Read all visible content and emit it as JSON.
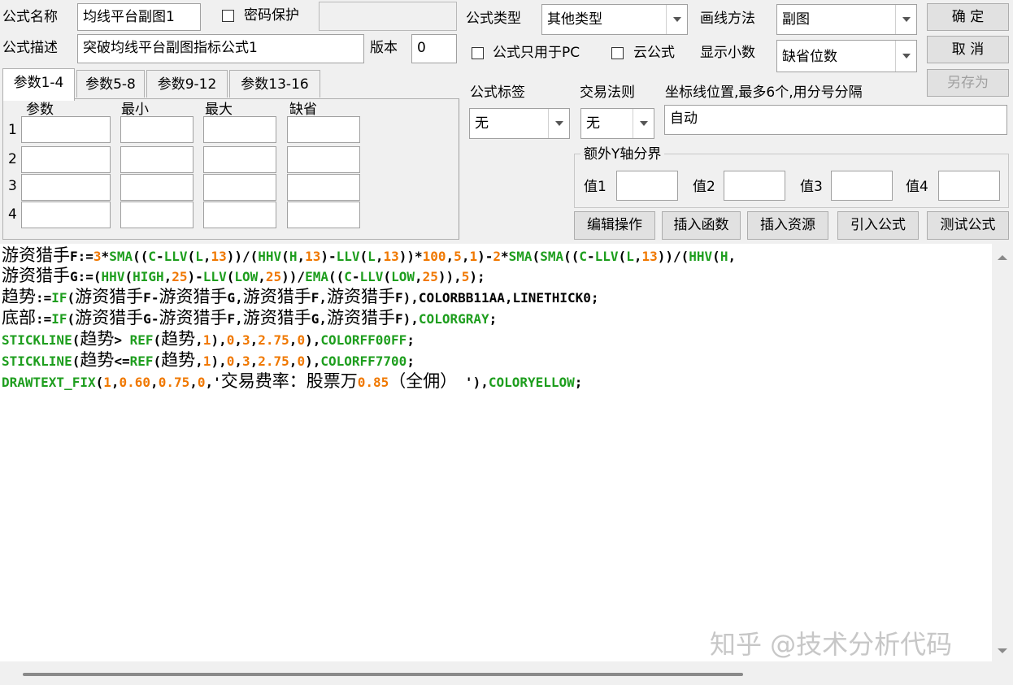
{
  "header": {
    "name_label": "公式名称",
    "name_value": "均线平台副图1",
    "password_label": "密码保护",
    "password_value": "",
    "desc_label": "公式描述",
    "desc_value": "突破均线平台副图指标公式1",
    "version_label": "版本",
    "version_value": "0",
    "type_label": "公式类型",
    "type_value": "其他类型",
    "draw_label": "画线方法",
    "draw_value": "副图",
    "pc_only_label": "公式只用于PC",
    "cloud_label": "云公式",
    "decimal_label": "显示小数",
    "decimal_value": "缺省位数"
  },
  "buttons": {
    "ok": "确  定",
    "cancel": "取  消",
    "save_as": "另存为",
    "edit_ops": "编辑操作",
    "insert_func": "插入函数",
    "insert_res": "插入资源",
    "import_formula": "引入公式",
    "test_formula": "测试公式"
  },
  "tabs": [
    "参数1-4",
    "参数5-8",
    "参数9-12",
    "参数13-16"
  ],
  "params": {
    "headers": [
      "参数",
      "最小",
      "最大",
      "缺省"
    ],
    "rows": [
      "1",
      "2",
      "3",
      "4"
    ]
  },
  "options": {
    "tag_label": "公式标签",
    "tag_value": "无",
    "trade_label": "交易法则",
    "trade_value": "无",
    "axis_label": "坐标线位置,最多6个,用分号分隔",
    "axis_value": "自动",
    "yaxis_group": "额外Y轴分界",
    "v1": "值1",
    "v2": "值2",
    "v3": "值3",
    "v4": "值4"
  },
  "code_lines": [
    "游资猎手F:=3*SMA((C-LLV(L,13))/(HHV(H,13)-LLV(L,13))*100,5,1)-2*SMA(SMA((C-LLV(L,13))/(HHV(H,",
    "游资猎手G:=(HHV(HIGH,25)-LLV(LOW,25))/EMA((C-LLV(LOW,25)),5);",
    "趋势:=IF(游资猎手F-游资猎手G,游资猎手F,游资猎手F),COLORBB11AA,LINETHICK0;",
    "底部:=IF(游资猎手G-游资猎手F,游资猎手G,游资猎手F),COLORGRAY;",
    "STICKLINE(趋势> REF(趋势,1),0,3,2.75,0),COLORFF00FF;",
    "STICKLINE(趋势<=REF(趋势,1),0,3,2.75,0),COLORFF7700;",
    "DRAWTEXT_FIX(1,0.60,0.75,0,'交易费率：股票万0.85（全佣） '),COLORYELLOW;"
  ],
  "watermark": "知乎 @技术分析代码",
  "colors": {
    "keyword": "#1e9e1e",
    "number": "#f07800",
    "text": "#000000"
  }
}
